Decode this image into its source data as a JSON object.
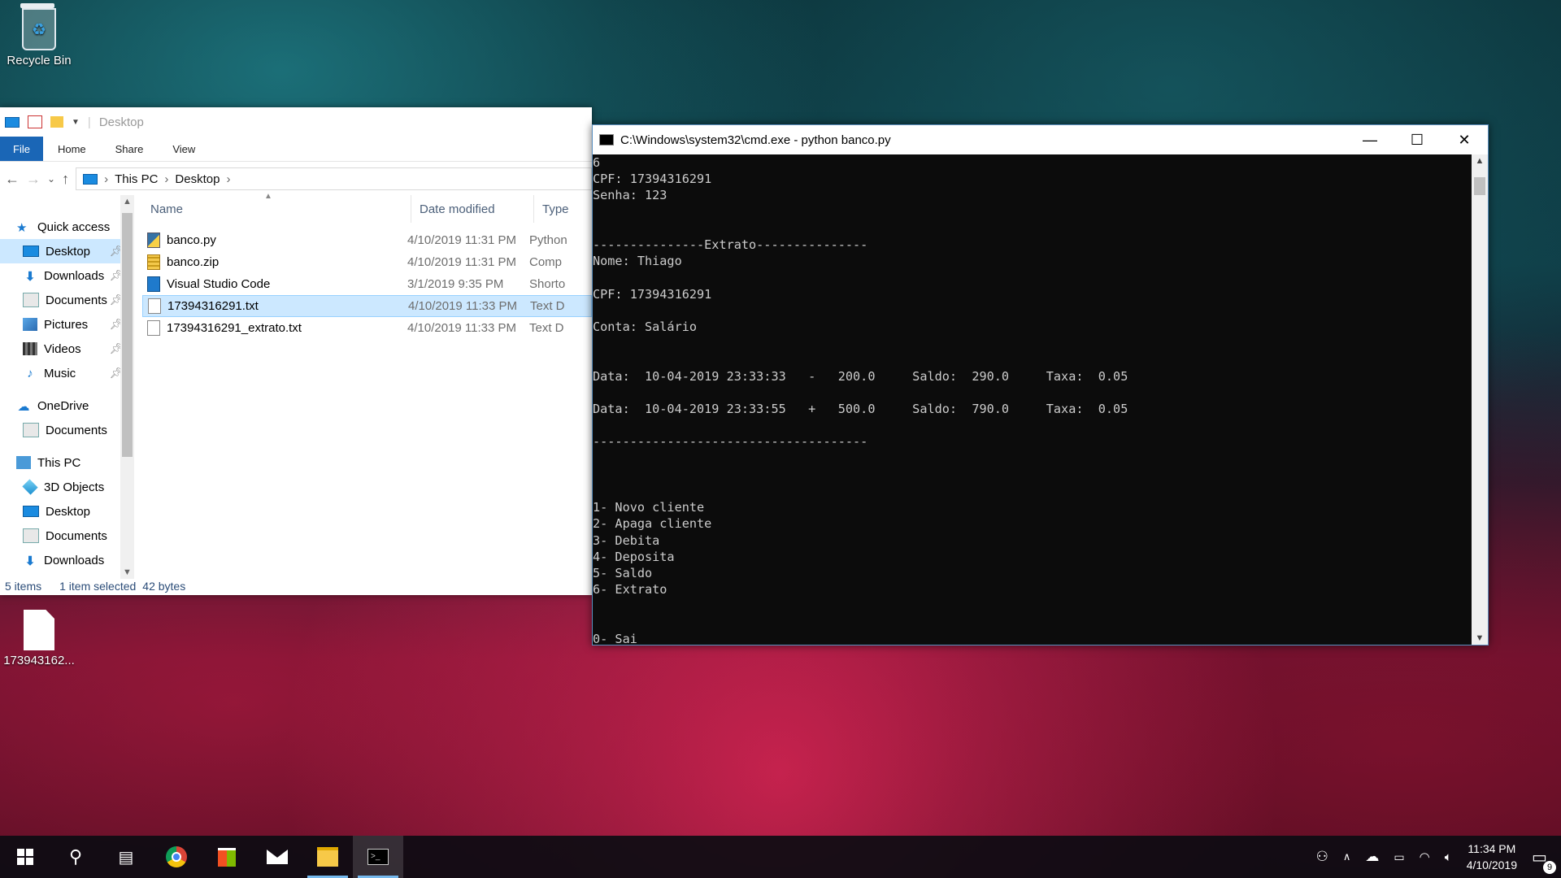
{
  "desktop": {
    "recycle_bin_label": "Recycle Bin",
    "file_icon_label": "173943162..."
  },
  "explorer": {
    "title": "Desktop",
    "ribbon_tabs": [
      "File",
      "Home",
      "Share",
      "View"
    ],
    "breadcrumb": [
      "This PC",
      "Desktop"
    ],
    "nav": {
      "quick_access": "Quick access",
      "qa_items": [
        "Desktop",
        "Downloads",
        "Documents",
        "Pictures",
        "Videos",
        "Music"
      ],
      "onedrive": "OneDrive",
      "onedrive_items": [
        "Documents"
      ],
      "this_pc": "This PC",
      "pc_items": [
        "3D Objects",
        "Desktop",
        "Documents",
        "Downloads"
      ]
    },
    "columns": [
      "Name",
      "Date modified",
      "Type"
    ],
    "files": [
      {
        "name": "banco.py",
        "date": "4/10/2019 11:31 PM",
        "type": "Python",
        "icon": "python-file-icon"
      },
      {
        "name": "banco.zip",
        "date": "4/10/2019 11:31 PM",
        "type": "Comp",
        "icon": "zip-file-icon"
      },
      {
        "name": "Visual Studio Code",
        "date": "3/1/2019 9:35 PM",
        "type": "Shorto",
        "icon": "vscode-shortcut-icon"
      },
      {
        "name": "17394316291.txt",
        "date": "4/10/2019 11:33 PM",
        "type": "Text D",
        "icon": "text-file-icon",
        "selected": true
      },
      {
        "name": "17394316291_extrato.txt",
        "date": "4/10/2019 11:33 PM",
        "type": "Text D",
        "icon": "text-file-icon"
      }
    ],
    "status": {
      "items": "5 items",
      "selected": "1 item selected",
      "size": "42 bytes"
    }
  },
  "cmd": {
    "title": "C:\\Windows\\system32\\cmd.exe - python  banco.py",
    "lines": [
      "6",
      "CPF: 17394316291",
      "Senha: 123",
      "",
      "",
      "---------------Extrato---------------",
      "Nome: Thiago",
      "",
      "CPF: 17394316291",
      "",
      "Conta: Salário",
      "",
      "",
      "Data:  10-04-2019 23:33:33   -   200.0     Saldo:  290.0     Taxa:  0.05",
      "",
      "Data:  10-04-2019 23:33:55   +   500.0     Saldo:  790.0     Taxa:  0.05",
      "",
      "-------------------------------------",
      "",
      "",
      "",
      "1- Novo cliente",
      "2- Apaga cliente",
      "3- Debita",
      "4- Deposita",
      "5- Saldo",
      "6- Extrato",
      "",
      "",
      "0- Sai"
    ]
  },
  "taskbar": {
    "time": "11:34 PM",
    "date": "4/10/2019",
    "notification_count": "9"
  }
}
